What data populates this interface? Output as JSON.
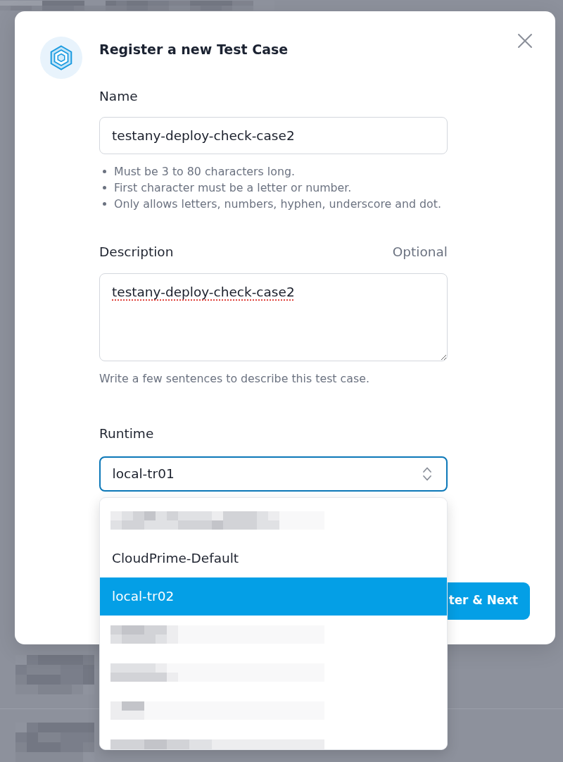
{
  "dialog": {
    "title": "Register a new Test Case",
    "fields": [
      {
        "kind": "input",
        "label": "Name",
        "value": "testany-deploy-check-case2",
        "hints": [
          "Must be 3 to 80 characters long.",
          "First character must be a letter or number.",
          "Only allows letters, numbers, hyphen, underscore and dot."
        ]
      },
      {
        "kind": "textarea",
        "label": "Description",
        "note": "Optional",
        "value": "testany-deploy-check-case2",
        "misspelled": true,
        "help": "Write a few sentences to describe this test case."
      },
      {
        "kind": "select",
        "label": "Runtime",
        "value": "local-tr01",
        "focused": true,
        "open": true,
        "options": [
          {
            "kind": "redacted",
            "selected": false
          },
          {
            "kind": "text",
            "label": "CloudPrime-Default",
            "selected": false
          },
          {
            "kind": "text",
            "label": "local-tr02",
            "selected": true
          },
          {
            "kind": "redacted",
            "selected": false
          },
          {
            "kind": "redacted",
            "selected": false
          },
          {
            "kind": "redacted",
            "selected": false
          },
          {
            "kind": "redacted",
            "selected": false
          }
        ]
      }
    ],
    "submit_button": {
      "label": "ter & Next"
    }
  }
}
